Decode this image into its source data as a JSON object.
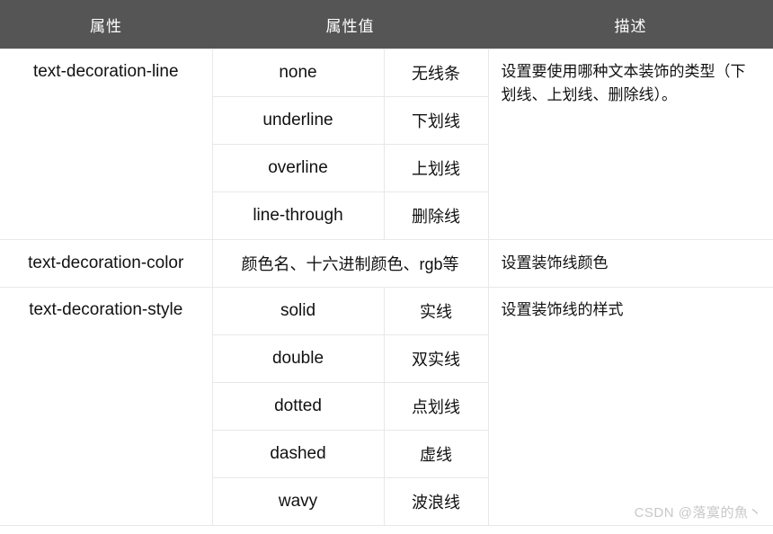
{
  "table": {
    "headers": [
      {
        "label": "属性",
        "span": 1
      },
      {
        "label": "属性值",
        "span": 2
      },
      {
        "label": "描述",
        "span": 1
      }
    ],
    "groups": [
      {
        "property": "text-decoration-line",
        "description": "设置要使用哪种文本装饰的类型（下划线、上划线、删除线）。",
        "values": [
          {
            "value": "none",
            "cn": "无线条"
          },
          {
            "value": "underline",
            "cn": "下划线"
          },
          {
            "value": "overline",
            "cn": "上划线"
          },
          {
            "value": "line-through",
            "cn": "删除线"
          }
        ]
      },
      {
        "property": "text-decoration-color",
        "description": "设置装饰线颜色",
        "merged_value": "颜色名、十六进制颜色、rgb等",
        "values": []
      },
      {
        "property": "text-decoration-style",
        "description": "设置装饰线的样式",
        "values": [
          {
            "value": "solid",
            "cn": "实线"
          },
          {
            "value": "double",
            "cn": "双实线"
          },
          {
            "value": "dotted",
            "cn": "点划线"
          },
          {
            "value": "dashed",
            "cn": "虚线"
          },
          {
            "value": "wavy",
            "cn": "波浪线"
          }
        ]
      }
    ]
  },
  "watermark": {
    "text": "CSDN @落寞的魚丶"
  },
  "colors": {
    "header_background": "#555555",
    "header_text": "#ffffff",
    "body_text": "#111111",
    "border": "#e8e8e8",
    "page_background": "#ffffff",
    "watermark_text": "#c8c8c8"
  }
}
